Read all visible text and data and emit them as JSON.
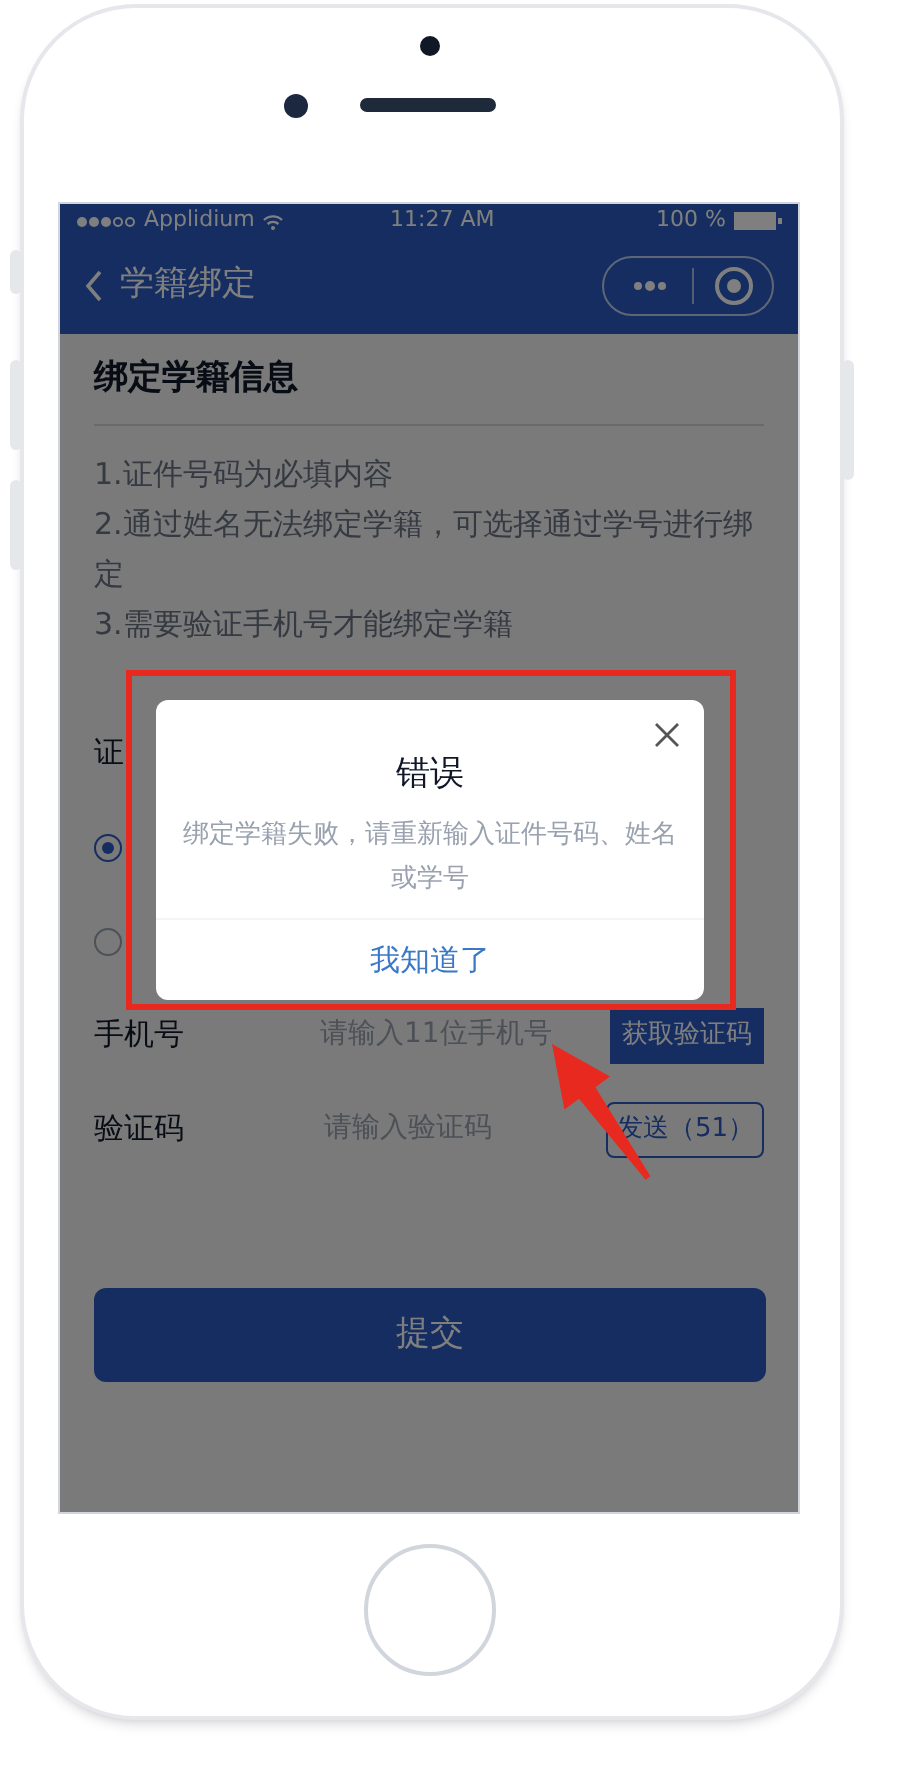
{
  "status_bar": {
    "carrier": "Applidium",
    "time": "11:27 AM",
    "battery": "100 %"
  },
  "nav": {
    "title": "学籍绑定"
  },
  "section_title": "绑定学籍信息",
  "notes": [
    "1.证件号码为必填内容",
    "2.通过姓名无法绑定学籍，可选择通过学号进行绑定",
    "3.需要验证手机号才能绑定学籍"
  ],
  "form": {
    "id_label": "证",
    "options": [
      {
        "selected": true
      },
      {
        "selected": false
      }
    ],
    "phone": {
      "label": "手机号",
      "placeholder": "请输入11位手机号",
      "button": "获取验证码"
    },
    "code": {
      "label": "验证码",
      "placeholder": "请输入验证码",
      "button": "发送（51）"
    },
    "submit": "提交"
  },
  "dialog": {
    "title": "错误",
    "message": "绑定学籍失败，请重新输入证件号码、姓名或学号",
    "button": "我知道了"
  }
}
